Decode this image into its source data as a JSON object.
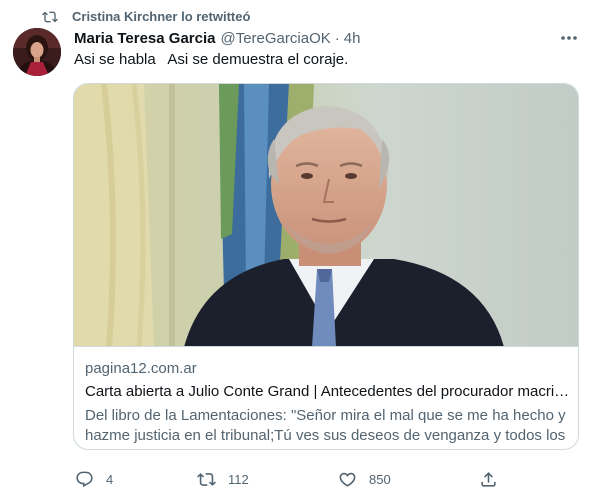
{
  "retweet_context": {
    "text": "Cristina Kirchner lo retwitteó",
    "icon": "retweet-icon"
  },
  "author": {
    "name": "Maria Teresa Garcia",
    "handle": "@TereGarciaOK",
    "separator": "·",
    "time": "4h"
  },
  "tweet": {
    "text": "Asi se habla   Asi se demuestra el coraje."
  },
  "link_card": {
    "domain": "pagina12.com.ar",
    "title": "Carta abierta a Julio Conte Grand | Antecedentes del procurador macrista",
    "description": "Del libro de la Lamentaciones: \"Señor mira el mal que se me ha hecho y hazme justicia en el tribunal;Tú ves sus deseos de venganza y todos los planes que tienen contra mí\""
  },
  "actions": {
    "replies": "4",
    "retweets": "112",
    "likes": "850"
  },
  "colors": {
    "text_primary": "#0f1419",
    "text_secondary": "#536471",
    "border": "#cfd9de",
    "background": "#ffffff"
  },
  "icons": [
    "retweet-icon",
    "more-icon",
    "reply-icon",
    "like-icon",
    "share-icon"
  ]
}
